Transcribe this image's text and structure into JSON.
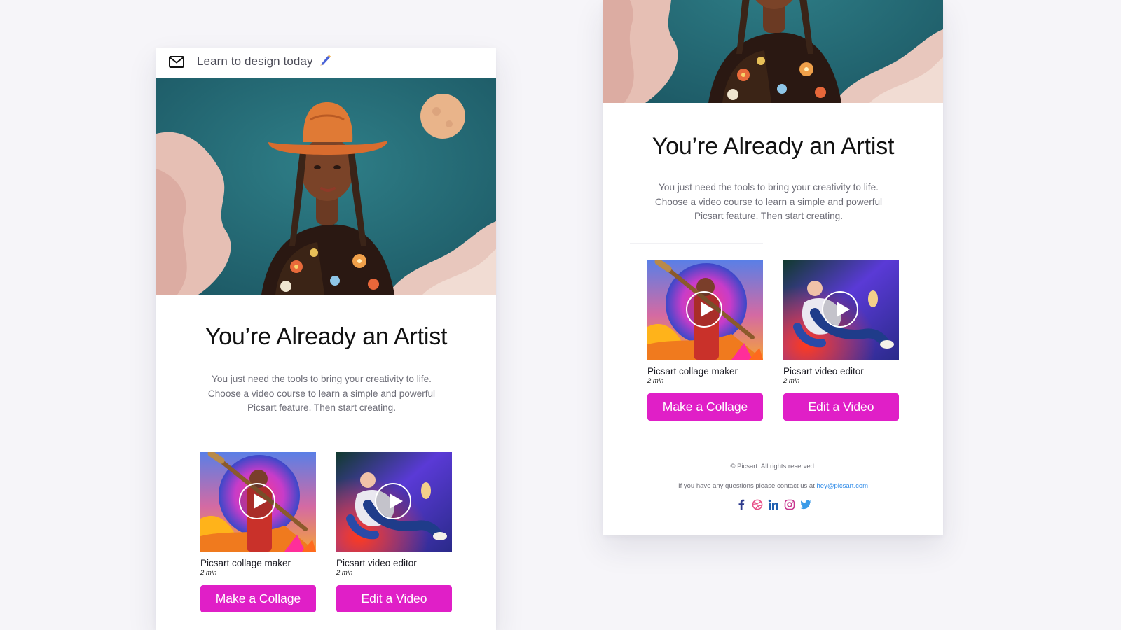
{
  "email_subject": {
    "text": "Learn to design today"
  },
  "email": {
    "headline": "You’re Already an Artist",
    "intro": "You just need the tools to bring your creativity to life. Choose a video course to learn a simple and powerful Picsart feature. Then start creating.",
    "courses": [
      {
        "title": "Picsart collage maker",
        "duration": "2 min",
        "button": "Make a Collage"
      },
      {
        "title": "Picsart video editor",
        "duration": "2 min",
        "button": "Edit a Video"
      }
    ],
    "footer": {
      "copyright": "© Picsart. All rights reserved.",
      "contact_prefix": "If you have any questions please contact us at",
      "contact_email": "hey@picsart.com",
      "social_icons": [
        "facebook-icon",
        "dribbble-icon",
        "linkedin-icon",
        "instagram-icon",
        "twitter-icon"
      ]
    }
  },
  "colors": {
    "accent": "#e01fc7",
    "link": "#2f8be8",
    "page_background": "#f6f5f9"
  }
}
